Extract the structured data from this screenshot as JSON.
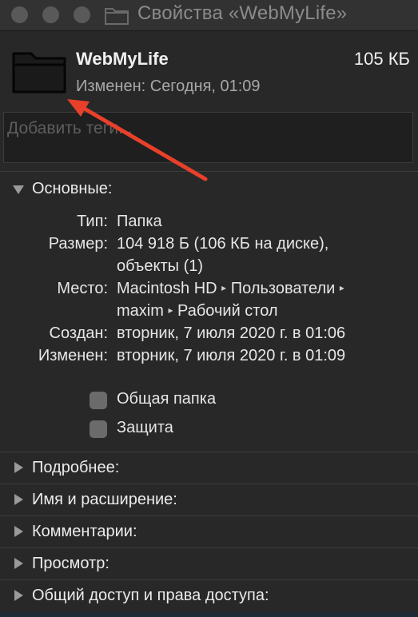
{
  "window": {
    "title": "Свойства «WebMyLife»"
  },
  "file": {
    "name": "WebMyLife",
    "size": "105 КБ",
    "modified": "Изменен: Сегодня, 01:09",
    "icon": "folder-icon"
  },
  "tags": {
    "placeholder": "Добавить теги..."
  },
  "general": {
    "label": "Основные:",
    "expanded": true,
    "rows": [
      {
        "key": "Тип:",
        "value": "Папка"
      },
      {
        "key": "Размер:",
        "value": "104 918 Б (106 КБ на диске),",
        "value2": "объекты (1)"
      },
      {
        "key": "Место:",
        "path1": [
          "Macintosh HD",
          "Пользователи"
        ],
        "path2": [
          "maxim",
          "Рабочий стол"
        ]
      },
      {
        "key": "Создан:",
        "value": "вторник, 7 июля 2020 г. в 01:06"
      },
      {
        "key": "Изменен:",
        "value": "вторник, 7 июля 2020 г. в 01:09"
      }
    ],
    "path_separator": "▸",
    "checkboxes": [
      {
        "label": "Общая папка",
        "checked": false
      },
      {
        "label": "Защита",
        "checked": false
      }
    ]
  },
  "sections": [
    {
      "label": "Подробнее:",
      "expanded": false
    },
    {
      "label": "Имя и расширение:",
      "expanded": false
    },
    {
      "label": "Комментарии:",
      "expanded": false
    },
    {
      "label": "Просмотр:",
      "expanded": false
    },
    {
      "label": "Общий доступ и права доступа:",
      "expanded": false
    }
  ],
  "colors": {
    "annotation_arrow": "#e8402a"
  }
}
